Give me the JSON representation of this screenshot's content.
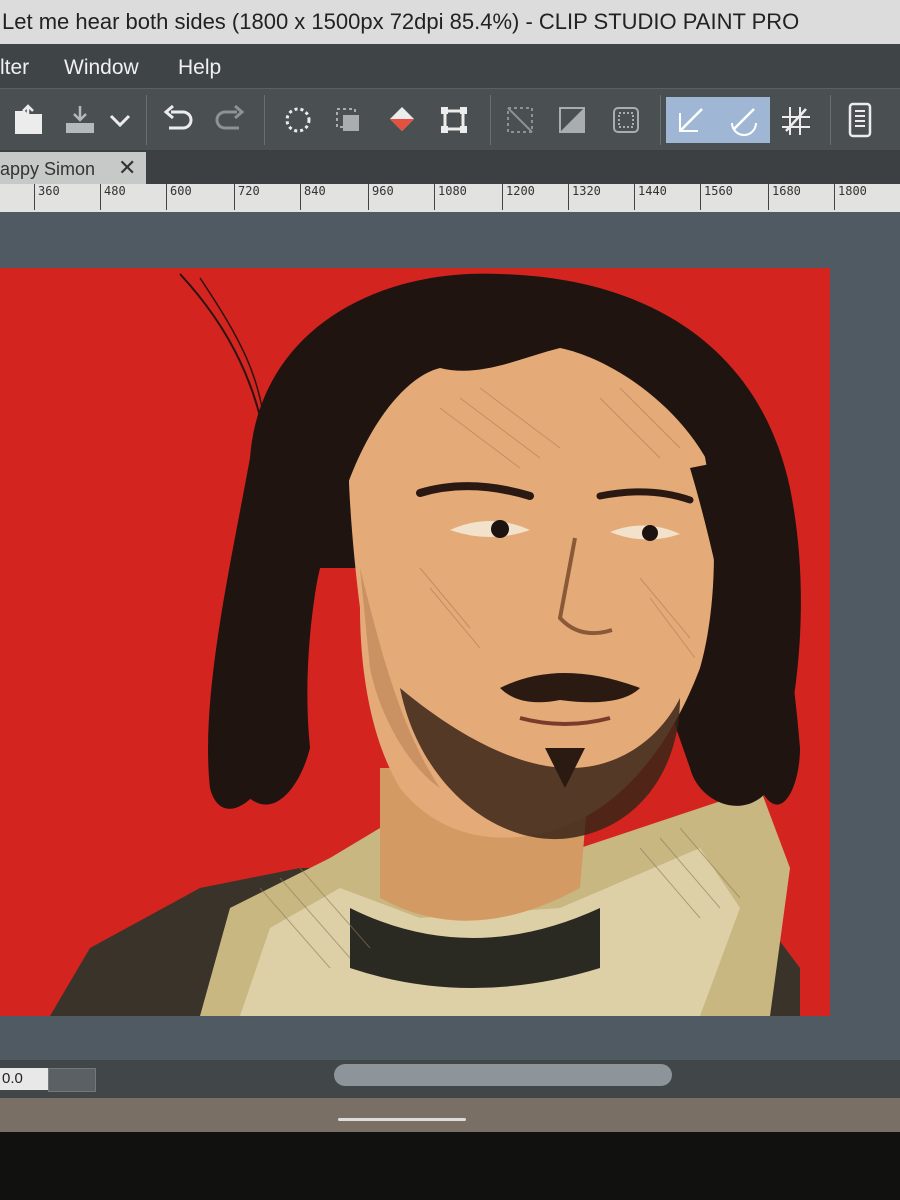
{
  "window": {
    "title": "Let me hear both sides (1800 x 1500px 72dpi 85.4%)  - CLIP STUDIO PAINT PRO"
  },
  "menubar": {
    "items": [
      "lter",
      "Window",
      "Help"
    ]
  },
  "toolbar": {
    "buttons": [
      "open-file-icon",
      "save-icon",
      "dropdown-chevron-icon",
      "undo-icon",
      "redo-icon",
      "clear-selection-icon",
      "crop-selection-icon",
      "fill-icon",
      "transform-icon",
      "hide-selection-icon",
      "invert-selection-icon",
      "select-icon",
      "snap-ruler-icon",
      "snap-special-ruler-icon",
      "snap-grid-icon",
      "tablet-icon"
    ],
    "active_color": "#9fb7d4"
  },
  "tab": {
    "label": "appy Simon",
    "close": "✕"
  },
  "ruler": {
    "labels": [
      "360",
      "480",
      "600",
      "720",
      "840",
      "960",
      "1080",
      "1200",
      "1320",
      "1440",
      "1560",
      "1680",
      "1800"
    ]
  },
  "canvas": {
    "background": "#d3241f"
  },
  "status": {
    "zoom_value": "0.0"
  }
}
